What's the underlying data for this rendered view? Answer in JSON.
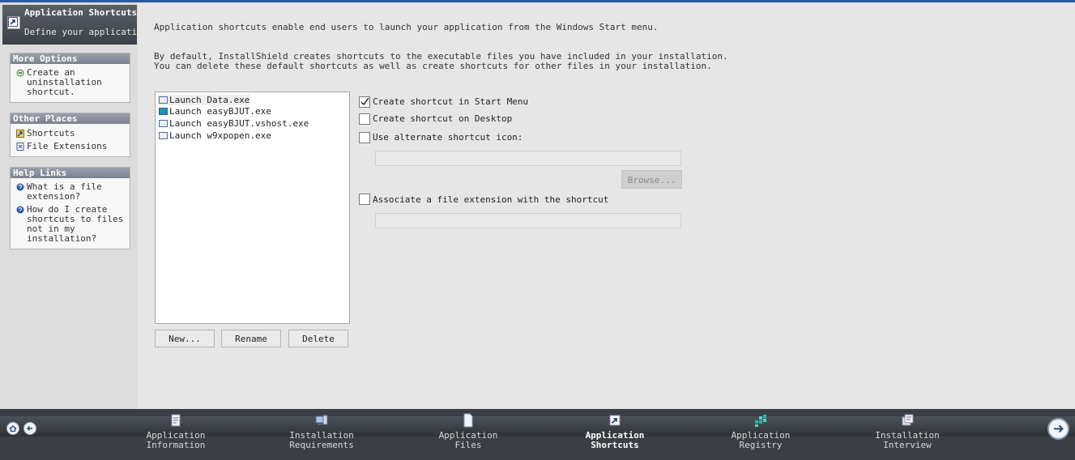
{
  "sidebar": {
    "header": {
      "title": "Application Shortcuts",
      "subtitle": "Define your application shortcuts."
    },
    "panels": [
      {
        "title": "More Options",
        "items": [
          {
            "label": "Create an uninstallation shortcut.",
            "icon": "uninstall-shortcut-icon"
          }
        ]
      },
      {
        "title": "Other Places",
        "items": [
          {
            "label": "Shortcuts",
            "icon": "shortcuts-icon"
          },
          {
            "label": "File Extensions",
            "icon": "file-extensions-icon"
          }
        ]
      },
      {
        "title": "Help Links",
        "items": [
          {
            "label": "What is a file extension?",
            "icon": "help-icon"
          },
          {
            "label": "How do I create shortcuts to files not in my installation?",
            "icon": "help-icon"
          }
        ]
      }
    ]
  },
  "main": {
    "intro1": "Application shortcuts enable end users to launch your application from the Windows Start menu.",
    "intro2_line1": "By default, InstallShield creates shortcuts to the executable files you have included in your installation.",
    "intro2_line2": "You can delete these default shortcuts as well as create shortcuts for other files in your installation.",
    "shortcuts": [
      {
        "label": "Launch Data.exe",
        "icon": "window-icon",
        "selected": true
      },
      {
        "label": "Launch easyBJUT.exe",
        "icon": "app-icon",
        "selected": false
      },
      {
        "label": "Launch easyBJUT.vshost.exe",
        "icon": "window-icon",
        "selected": false
      },
      {
        "label": "Launch w9xpopen.exe",
        "icon": "window-icon",
        "selected": false
      }
    ],
    "buttons": {
      "new": "New...",
      "rename": "Rename",
      "delete": "Delete"
    },
    "options": {
      "start_menu": {
        "label": "Create shortcut in Start Menu",
        "checked": true
      },
      "desktop": {
        "label": "Create shortcut on Desktop",
        "checked": false
      },
      "alt_icon": {
        "label": "Use alternate shortcut icon:",
        "checked": false
      },
      "browse": "Browse...",
      "file_ext": {
        "label": "Associate a file extension with the shortcut",
        "checked": false
      }
    }
  },
  "bottom_nav": {
    "steps": [
      {
        "line1": "Application",
        "line2": "Information",
        "icon": "info-document-icon",
        "active": false
      },
      {
        "line1": "Installation",
        "line2": "Requirements",
        "icon": "computer-requirements-icon",
        "active": false
      },
      {
        "line1": "Application",
        "line2": "Files",
        "icon": "files-icon",
        "active": false
      },
      {
        "line1": "Application",
        "line2": "Shortcuts",
        "icon": "shortcut-icon",
        "active": true
      },
      {
        "line1": "Application",
        "line2": "Registry",
        "icon": "registry-icon",
        "active": false
      },
      {
        "line1": "Installation",
        "line2": "Interview",
        "icon": "interview-icon",
        "active": false
      }
    ]
  }
}
